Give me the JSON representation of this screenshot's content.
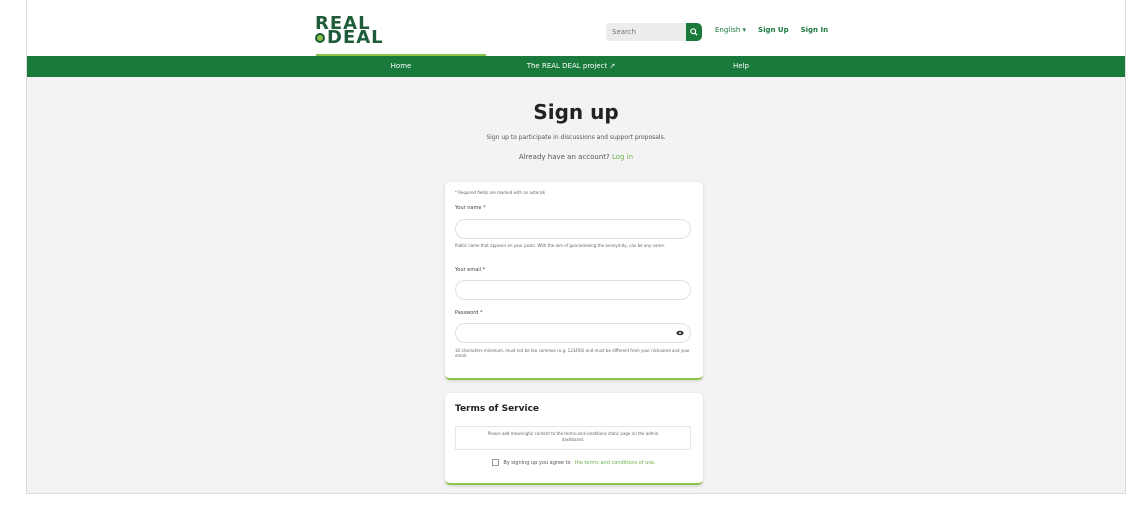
{
  "header": {
    "logo_line1": "REAL",
    "logo_line2": "DEAL",
    "search_placeholder": "Search",
    "language": "English",
    "sign_up": "Sign Up",
    "sign_in": "Sign In"
  },
  "nav": {
    "items": [
      {
        "label": "Home"
      },
      {
        "label": "The REAL DEAL project ↗"
      },
      {
        "label": "Help"
      }
    ]
  },
  "page": {
    "title": "Sign up",
    "subtitle": "Sign up to participate in discussions and support proposals.",
    "already_text": "Already have an account?",
    "login_link": "Log in"
  },
  "form": {
    "required_note": "* Required fields are marked with an asterisk",
    "name_label": "Your name *",
    "name_hint": "Public name that appears on your posts. With the aim of guaranteeing the anonymity, can be any name.",
    "email_label": "Your email *",
    "password_label": "Password *",
    "password_hint": "10 characters minimum, must not be too common (e.g. 123456) and must be different from your nickname and your email."
  },
  "tos": {
    "title": "Terms of Service",
    "body": "Please add meaningful content to the terms-and-conditions static page on the admin dashboard.",
    "agree_text": "By signing up you agree to",
    "agree_link": "the terms and conditions of use."
  },
  "colors": {
    "brand_green": "#1a7a3c",
    "accent_light_green": "#8bc34a"
  }
}
